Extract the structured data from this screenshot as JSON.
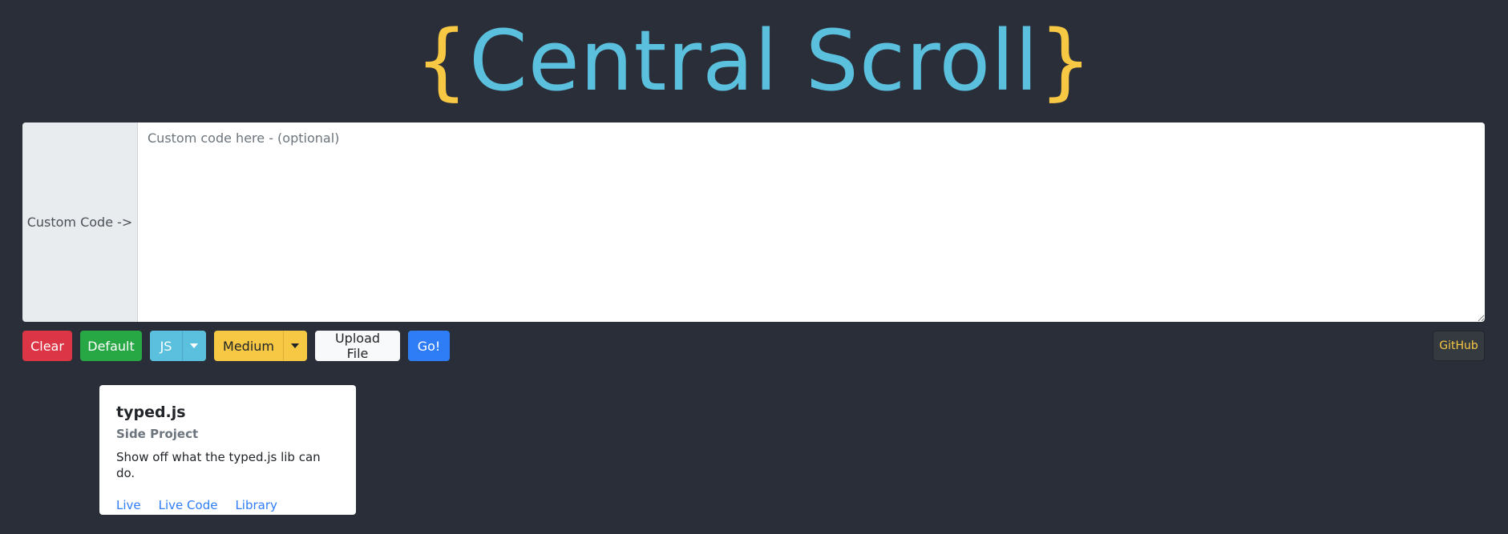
{
  "header": {
    "brace_open": "{",
    "title": "Central Scroll",
    "brace_close": "}"
  },
  "editor": {
    "label": "Custom Code ->",
    "value": "",
    "placeholder": "Custom code here - (optional)"
  },
  "toolbar": {
    "clear_label": "Clear",
    "default_label": "Default",
    "language_label": "JS",
    "speed_label": "Medium",
    "upload_label": "Upload File",
    "go_label": "Go!",
    "github_label": "GitHub"
  },
  "card": {
    "title": "typed.js",
    "subtitle": "Side Project",
    "text": "Show off what the typed.js lib can do.",
    "links": [
      "Live",
      "Live Code",
      "Library"
    ]
  },
  "colors": {
    "background": "#2a2e38",
    "title": "#5bc0de",
    "brace": "#f7c843",
    "danger": "#dc3545",
    "success": "#28a745",
    "info": "#5bc0de",
    "warning": "#f7c843",
    "primary": "#2e7cf6"
  },
  "icons": {
    "dropdown": "caret-down-icon"
  }
}
